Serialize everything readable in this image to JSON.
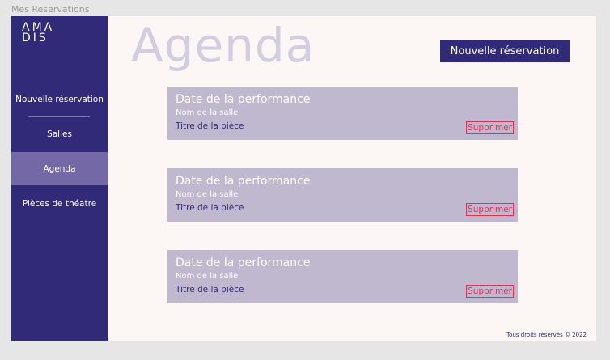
{
  "frame_label": "Mes Reservations",
  "logo": {
    "line1": "AMA",
    "line2": "DIS"
  },
  "sidebar": {
    "items": [
      {
        "label": "Nouvelle réservation"
      },
      {
        "label": "Salles"
      },
      {
        "label": "Agenda",
        "active": true
      },
      {
        "label": "Pièces de théatre"
      }
    ]
  },
  "header": {
    "title": "Agenda",
    "new_button_label": "Nouvelle réservation"
  },
  "reservations": [
    {
      "date": "Date de la performance",
      "room": "Nom de la salle",
      "piece": "Titre de la pièce",
      "delete_label": "Supprimer"
    },
    {
      "date": "Date de la performance",
      "room": "Nom de la salle",
      "piece": "Titre de la pièce",
      "delete_label": "Supprimer"
    },
    {
      "date": "Date de la performance",
      "room": "Nom de la salle",
      "piece": "Titre de la pièce",
      "delete_label": "Supprimer"
    }
  ],
  "footer": {
    "text": "Tous droits réservés © 2022"
  },
  "colors": {
    "primary": "#302a78",
    "active_nav": "#7469a6",
    "card": "#bfb8cf",
    "title": "#d4cde1",
    "danger": "#e0335a",
    "background": "#fcf6f4"
  }
}
